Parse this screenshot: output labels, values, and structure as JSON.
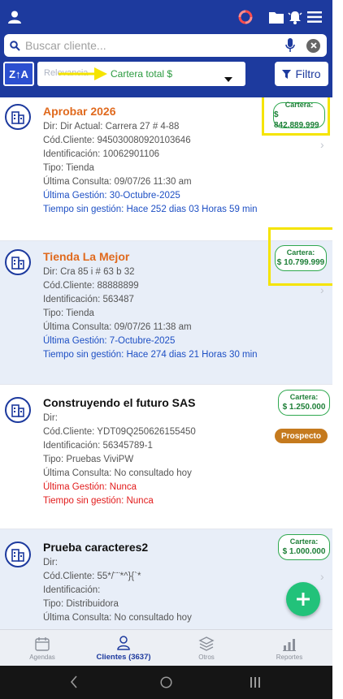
{
  "header": {
    "search": {
      "placeholder": "Buscar cliente...",
      "value": ""
    },
    "sort": {
      "button_label": "Z↑A",
      "behind_text": "Relevancia",
      "selected": "Cartera total $"
    },
    "filter_label": "Filtro",
    "icons": [
      "user-icon",
      "sync-icon",
      "folder-icon",
      "bell-icon",
      "menu-icon"
    ]
  },
  "clients": [
    {
      "name": "Aprobar 2026",
      "address": "Dir: Dir Actual: Carrera 27 # 4-88",
      "code": "Cód.Cliente: 945030080920103646",
      "id": "Identificación: 10062901106",
      "type": "Tipo: Tienda",
      "last_query": "Última Consulta: 09/07/26 11:30 am",
      "last_management": "Última Gestión: 30-Octubre-2025",
      "time_without": "Tiempo sin gestión: Hace 252 dias 03 Horas 59 min",
      "cartera_label": "Cartera:",
      "cartera_value": "$ 842.889.999"
    },
    {
      "name": "Tienda La Mejor",
      "address": "Dir: Cra 85 i # 63 b 32",
      "code": "Cód.Cliente: 88888899",
      "id": "Identificación: 563487",
      "type": "Tipo: Tienda",
      "last_query": "Última Consulta: 09/07/26 11:38 am",
      "last_management": "Última Gestión: 7-Octubre-2025",
      "time_without": "Tiempo sin gestión: Hace 274 dias 21 Horas 30 min",
      "cartera_label": "Cartera:",
      "cartera_value": "$ 10.799.999"
    },
    {
      "name": "Construyendo el futuro SAS",
      "address": "Dir:",
      "code": "Cód.Cliente: YDT09Q250626155450",
      "id": "Identificación: 56345789-1",
      "type": "Tipo: Pruebas ViviPW",
      "last_query": "Última Consulta: No consultado hoy",
      "last_management": "Última Gestión: Nunca",
      "time_without": "Tiempo sin gestión: Nunca",
      "cartera_label": "Cartera:",
      "cartera_value": "$ 1.250.000",
      "badge": "Prospecto"
    },
    {
      "name": "Prueba caracteres2",
      "address": "Dir:",
      "code": "Cód.Cliente: 55*/¨¨*^}{`*",
      "id": "Identificación:",
      "type": "Tipo: Distribuidora",
      "last_query": "Última Consulta: No consultado hoy",
      "cartera_label": "Cartera:",
      "cartera_value": "$ 1.000.000"
    }
  ],
  "bottom_nav": [
    {
      "label": "Agendas",
      "icon": "calendar-icon"
    },
    {
      "label": "Clientes (3637)",
      "icon": "clients-icon",
      "active": true
    },
    {
      "label": "Otros",
      "icon": "layers-icon"
    },
    {
      "label": "Reportes",
      "icon": "chart-icon"
    }
  ],
  "colors": {
    "header": "#1d3a9e",
    "accent_orange": "#e06a1e",
    "link_blue": "#1d4fc4",
    "alert_red": "#e21b1b",
    "cartera_green": "#1e7f38",
    "fab_green": "#22c27a",
    "highlight_yellow": "#f5e400"
  }
}
